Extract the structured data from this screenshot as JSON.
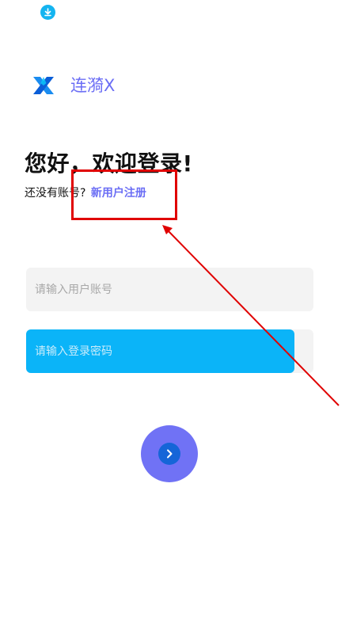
{
  "status_bar": {
    "icon": "download-icon"
  },
  "header": {
    "logo_icon": "x-logo-icon",
    "app_name": "连漪X"
  },
  "login": {
    "greeting": "您好，欢迎登录!",
    "no_account_prompt": "还没有账号?",
    "register_link": "新用户注册",
    "username_placeholder": "请输入用户账号",
    "password_placeholder": "请输入登录密码",
    "submit_icon": "chevron-right-icon"
  },
  "annotation": {
    "color": "#e00000",
    "description_target": "register-link"
  },
  "colors": {
    "accent": "#6b6ef5",
    "submit_button": "#7072f5",
    "password_highlight": "#0bb4f8",
    "field_background": "#f3f3f3"
  }
}
